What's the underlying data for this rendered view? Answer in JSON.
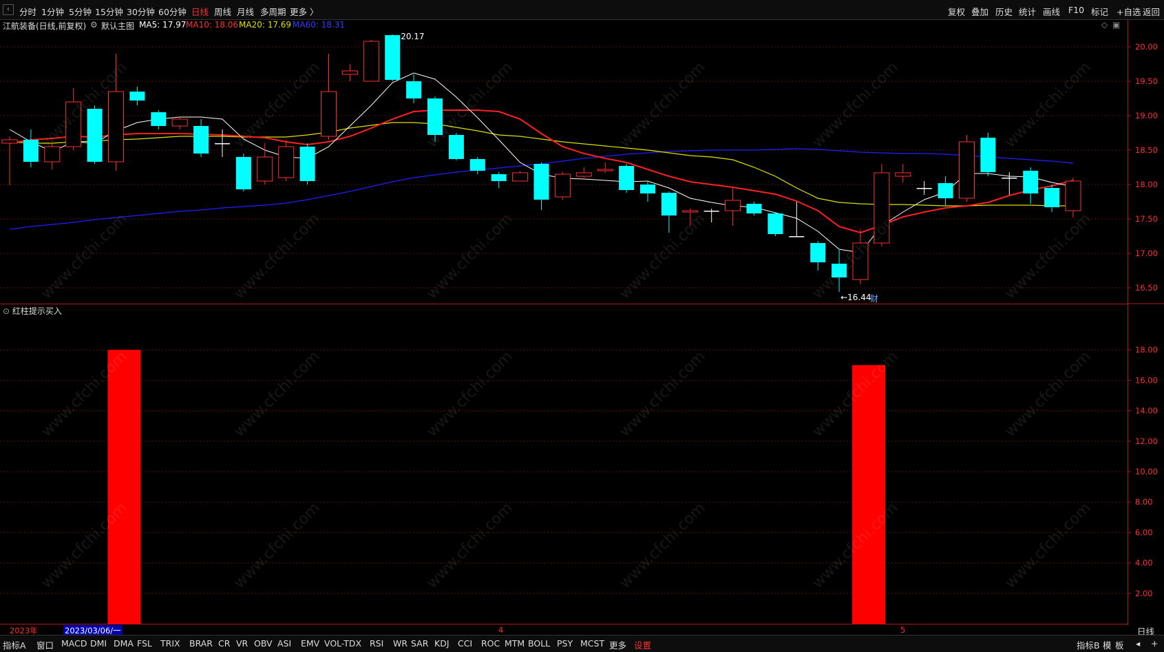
{
  "toolbar": {
    "tabs": [
      "分时",
      "1分钟",
      "5分钟",
      "15分钟",
      "30分钟",
      "60分钟",
      "日线",
      "周线",
      "月线",
      "多周期",
      "更多 〉"
    ],
    "active_tab": "日线",
    "right_tools": [
      "复权",
      "叠加",
      "历史",
      "统计",
      "画线",
      "F10",
      "标记",
      "+自选",
      "返回"
    ]
  },
  "info": {
    "stock_title": "江航装备(日线,前复权)",
    "main_chart_label": "默认主图",
    "ma5": "MA5: 17.97",
    "ma10": "MA10: 18.06",
    "ma20": "MA20: 17.69",
    "ma60": "MA60: 18.31"
  },
  "colors": {
    "up": "#ff3030",
    "down": "#00ffff",
    "ma5": "#ffffff",
    "ma10": "#ff2020",
    "ma20": "#e0e000",
    "ma60": "#2020ff",
    "grid": "#5a1010",
    "accent_red": "#ff0000"
  },
  "annotations": {
    "high": "20.17",
    "low": "←16.44",
    "finance_marker": "财"
  },
  "sub_indicator": {
    "title": "红柱提示买入",
    "icon": "chevron-down-icon"
  },
  "date_bar": {
    "year": "2023年",
    "cursor_date": "2023/03/06/一",
    "month_4": "4",
    "month_5": "5"
  },
  "period_label": "日线",
  "bottom_tabs": [
    "指标A",
    "窗口",
    "MACD",
    "DMI",
    "DMA",
    "FSL",
    "TRIX",
    "BRAR",
    "CR",
    "VR",
    "OBV",
    "ASI",
    "EMV",
    "VOL-TDX",
    "RSI",
    "WR",
    "SAR",
    "KDJ",
    "CCI",
    "ROC",
    "MTM",
    "BOLL",
    "PSY",
    "MCST",
    "更多",
    "设置"
  ],
  "bottom_right": [
    "指标B",
    "模",
    "板",
    "◂",
    "+"
  ],
  "watermark_text": "www.cfchi.com",
  "chart_data": [
    {
      "type": "candlestick",
      "title": "江航装备(日线,前复权)",
      "ylim": [
        16.3,
        20.2
      ],
      "yticks": [
        "20.00",
        "19.50",
        "19.00",
        "18.50",
        "18.00",
        "17.50",
        "17.00",
        "16.50"
      ],
      "candles": [
        [
          18.6,
          18.65,
          17.99,
          18.7
        ],
        [
          18.65,
          18.33,
          18.25,
          18.8
        ],
        [
          18.33,
          18.55,
          18.22,
          18.6
        ],
        [
          18.55,
          19.2,
          18.5,
          19.4
        ],
        [
          19.1,
          18.33,
          18.3,
          19.15
        ],
        [
          18.33,
          19.35,
          18.2,
          19.9
        ],
        [
          19.35,
          19.22,
          19.15,
          19.42
        ],
        [
          19.05,
          18.85,
          18.8,
          19.08
        ],
        [
          18.85,
          18.95,
          18.8,
          18.98
        ],
        [
          18.85,
          18.45,
          18.4,
          18.95
        ],
        [
          18.6,
          18.6,
          18.4,
          18.8
        ],
        [
          18.4,
          17.93,
          17.9,
          18.45
        ],
        [
          18.05,
          18.4,
          18.0,
          18.6
        ],
        [
          18.1,
          18.55,
          18.05,
          18.65
        ],
        [
          18.55,
          18.05,
          18.0,
          18.6
        ],
        [
          18.7,
          19.35,
          18.65,
          19.9
        ],
        [
          19.6,
          19.65,
          19.5,
          19.75
        ],
        [
          19.5,
          20.08,
          19.5,
          20.1
        ],
        [
          20.17,
          19.52,
          19.5,
          20.18
        ],
        [
          19.5,
          19.25,
          19.18,
          19.6
        ],
        [
          19.25,
          18.72,
          18.62,
          19.28
        ],
        [
          18.72,
          18.37,
          18.35,
          18.75
        ],
        [
          18.37,
          18.2,
          18.15,
          18.4
        ],
        [
          18.15,
          18.05,
          17.95,
          18.18
        ],
        [
          18.05,
          18.17,
          18.05,
          18.2
        ],
        [
          18.3,
          17.78,
          17.63,
          18.32
        ],
        [
          17.82,
          18.15,
          17.78,
          18.18
        ],
        [
          18.12,
          18.17,
          18.1,
          18.25
        ],
        [
          18.2,
          18.22,
          18.17,
          18.32
        ],
        [
          18.27,
          17.92,
          17.88,
          18.3
        ],
        [
          18.0,
          17.87,
          17.75,
          18.05
        ],
        [
          17.88,
          17.55,
          17.3,
          17.9
        ],
        [
          17.6,
          17.62,
          17.4,
          17.65
        ],
        [
          17.62,
          17.62,
          17.45,
          17.65
        ],
        [
          17.62,
          17.77,
          17.4,
          17.95
        ],
        [
          17.72,
          17.58,
          17.55,
          17.75
        ],
        [
          17.58,
          17.28,
          17.25,
          17.6
        ],
        [
          17.25,
          17.25,
          17.25,
          17.75
        ],
        [
          17.15,
          16.87,
          16.75,
          17.18
        ],
        [
          16.85,
          16.65,
          16.44,
          17.05
        ],
        [
          16.62,
          17.15,
          16.55,
          17.35
        ],
        [
          17.15,
          18.17,
          17.1,
          18.3
        ],
        [
          18.12,
          18.17,
          18.03,
          18.3
        ],
        [
          17.95,
          17.95,
          17.85,
          18.05
        ],
        [
          18.02,
          17.8,
          17.7,
          18.12
        ],
        [
          17.8,
          18.62,
          17.75,
          18.72
        ],
        [
          18.68,
          18.18,
          18.12,
          18.75
        ],
        [
          18.1,
          18.1,
          17.85,
          18.18
        ],
        [
          18.2,
          17.87,
          17.72,
          18.25
        ],
        [
          17.95,
          17.67,
          17.6,
          18.0
        ],
        [
          17.62,
          18.05,
          17.52,
          18.1
        ]
      ],
      "ma5": [
        18.8,
        18.62,
        18.48,
        18.62,
        18.6,
        18.78,
        18.9,
        18.95,
        18.98,
        18.98,
        18.95,
        18.66,
        18.5,
        18.4,
        18.38,
        18.55,
        18.85,
        19.15,
        19.48,
        19.62,
        19.53,
        19.27,
        18.97,
        18.65,
        18.32,
        18.15,
        18.09,
        18.08,
        18.06,
        18.04,
        18.05,
        17.95,
        17.8,
        17.74,
        17.69,
        17.67,
        17.59,
        17.51,
        17.32,
        17.06,
        17.01,
        17.4,
        17.6,
        17.78,
        17.89,
        18.16,
        18.16,
        18.12,
        18.11,
        18.03,
        17.97
      ],
      "ma10": [
        18.6,
        18.65,
        18.67,
        18.7,
        18.69,
        18.72,
        18.74,
        18.74,
        18.74,
        18.73,
        18.72,
        18.7,
        18.68,
        18.62,
        18.58,
        18.62,
        18.7,
        18.82,
        18.95,
        19.06,
        19.08,
        19.08,
        19.08,
        19.06,
        18.95,
        18.74,
        18.55,
        18.45,
        18.38,
        18.32,
        18.22,
        18.12,
        18.04,
        18.0,
        17.96,
        17.91,
        17.86,
        17.76,
        17.62,
        17.39,
        17.3,
        17.41,
        17.53,
        17.6,
        17.66,
        17.69,
        17.74,
        17.84,
        17.92,
        17.98,
        18.06
      ],
      "ma20": [
        18.62,
        18.6,
        18.6,
        18.62,
        18.63,
        18.65,
        18.66,
        18.68,
        18.7,
        18.7,
        18.7,
        18.69,
        18.69,
        18.69,
        18.72,
        18.76,
        18.82,
        18.86,
        18.9,
        18.9,
        18.88,
        18.83,
        18.78,
        18.72,
        18.7,
        18.66,
        18.62,
        18.59,
        18.56,
        18.53,
        18.5,
        18.46,
        18.42,
        18.4,
        18.36,
        18.25,
        18.12,
        17.95,
        17.8,
        17.74,
        17.72,
        17.71,
        17.71,
        17.7,
        17.69,
        17.69,
        17.7,
        17.7,
        17.7,
        17.69,
        17.69
      ],
      "ma60": [
        17.35,
        17.39,
        17.42,
        17.45,
        17.49,
        17.52,
        17.55,
        17.58,
        17.61,
        17.63,
        17.66,
        17.68,
        17.7,
        17.73,
        17.78,
        17.84,
        17.9,
        17.97,
        18.04,
        18.1,
        18.14,
        18.18,
        18.21,
        18.24,
        18.27,
        18.3,
        18.34,
        18.38,
        18.41,
        18.44,
        18.46,
        18.48,
        18.49,
        18.5,
        18.5,
        18.5,
        18.51,
        18.52,
        18.51,
        18.49,
        18.47,
        18.46,
        18.45,
        18.45,
        18.44,
        18.42,
        18.4,
        18.38,
        18.36,
        18.34,
        18.31
      ]
    },
    {
      "type": "bar",
      "title": "红柱提示买入",
      "ylim": [
        0,
        20
      ],
      "yticks": [
        "18.00",
        "16.00",
        "14.00",
        "12.00",
        "10.00",
        "8.00",
        "6.00",
        "4.00",
        "2.00"
      ],
      "bars": [
        {
          "index": 5,
          "value": 18.0
        },
        {
          "index": 40,
          "value": 17.0
        }
      ]
    }
  ]
}
